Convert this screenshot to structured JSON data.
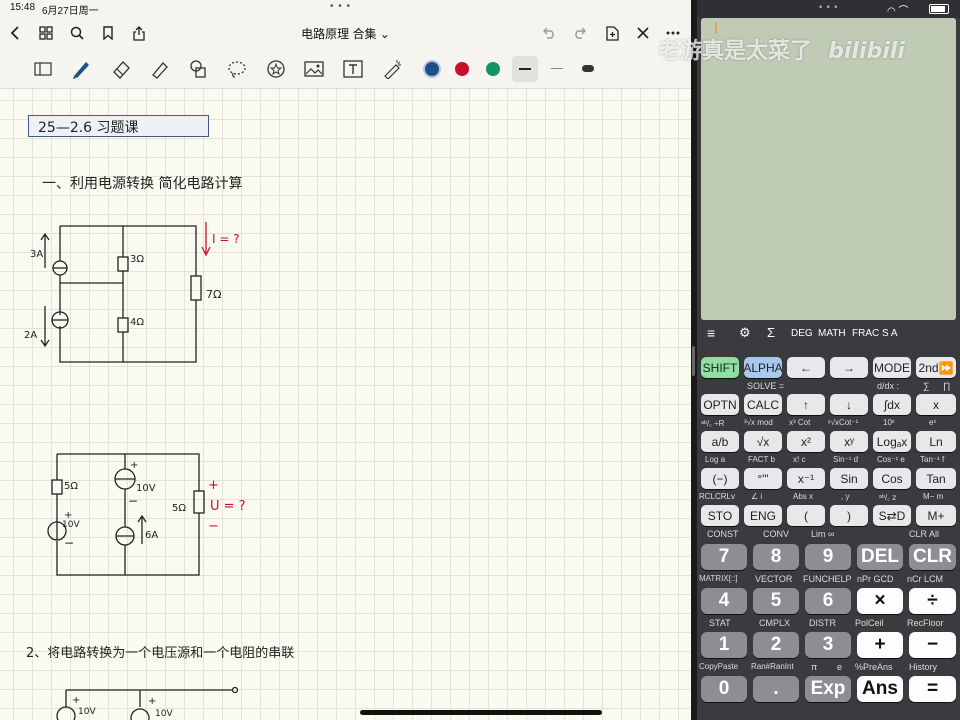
{
  "status_bar": {
    "time": "15:48",
    "date": "6月27日周一"
  },
  "nav": {
    "title": "电路原理 合集 ⌄"
  },
  "toolbar": {
    "tools": [
      "sidebar-icon",
      "pen-icon",
      "eraser-icon",
      "highlighter-icon",
      "shapes-icon",
      "lasso-icon",
      "sticker-icon",
      "image-icon",
      "text-icon",
      "laser-icon"
    ],
    "colors": [
      "#1f4f8b",
      "#c8102e",
      "#139468"
    ]
  },
  "notes": {
    "title": "25—2.6  习题课",
    "section1": "一、利用电源转换 简化电路计算",
    "c1": {
      "src1": "3A",
      "src2": "2A",
      "r1": "3Ω",
      "r2": "4Ω",
      "r3": "7Ω",
      "question": "I = ?"
    },
    "c2": {
      "r1": "5Ω",
      "v1": "10V",
      "v2": "10V",
      "i1": "6A",
      "r2": "5Ω",
      "question": "U = ?",
      "plus": "+",
      "minus": "−"
    },
    "section2": "2、将电路转换为一个电压源和一个电阻的串联",
    "c3": {
      "v1": "10V",
      "v2": "10V",
      "plus": "+"
    }
  },
  "watermark": {
    "text": "老游真是太菜了",
    "logo": "bilibili"
  },
  "calc": {
    "menu": {
      "menu": "≡",
      "settings": "⚙",
      "sigma": "Σ",
      "deg": "DEG",
      "math": "MATH",
      "frac": "FRAC",
      "sa": "S A"
    },
    "row1": [
      "SHIFT",
      "ALPHA",
      "←",
      "→",
      "MODE",
      "2nd⏩"
    ],
    "sub1": {
      "solve": "SOLVE =",
      "ddx": "d/dx :",
      "sum": "∑",
      "prod": "∏"
    },
    "row2": [
      "OPTN",
      "CALC",
      "↑",
      "↓",
      "∫dx",
      "x"
    ],
    "sub2": [
      "ᵃᵇ/꜀ ÷R",
      "³√x mod",
      "x³ Cot",
      "ʸ√xCot⁻¹",
      "10ˣ",
      "eˣ"
    ],
    "row3": [
      "a/b",
      "√x",
      "x²",
      "xʸ",
      "Logₐx",
      "Ln"
    ],
    "sub3": [
      "Log a",
      "FACT b",
      "x! c",
      "Sin⁻¹ d",
      "Cos⁻¹ e",
      "Tan⁻¹ f"
    ],
    "row4": [
      "(−)",
      "°'\"",
      "x⁻¹",
      "Sin",
      "Cos",
      "Tan"
    ],
    "sub4": [
      "RCLCRLv",
      "∠ i",
      "Abs x",
      ", y",
      "ᵃᵇ/꜀ z",
      "M− m"
    ],
    "row5": [
      "STO",
      "ENG",
      "(",
      ")",
      "S⇄D",
      "M+"
    ],
    "sub5": [
      "CONST",
      "CONV",
      "Lim ∞",
      "CLR All"
    ],
    "row6": [
      "7",
      "8",
      "9",
      "DEL",
      "CLR"
    ],
    "sub6": [
      "MATRIX[::]",
      "VECTOR",
      "FUNCHELP",
      "nPr GCD",
      "nCr LCM"
    ],
    "row7": [
      "4",
      "5",
      "6",
      "×",
      "÷"
    ],
    "sub7": [
      "STAT",
      "CMPLX",
      "DISTR",
      "PolCeil",
      "RecFloor"
    ],
    "row8": [
      "1",
      "2",
      "3",
      "+",
      "−"
    ],
    "sub8": [
      "CopyPaste",
      "Ran#RanInt",
      "π",
      "e",
      "%PreAns",
      "History"
    ],
    "row9": [
      "0",
      ".",
      "Exp",
      "Ans",
      "="
    ]
  }
}
